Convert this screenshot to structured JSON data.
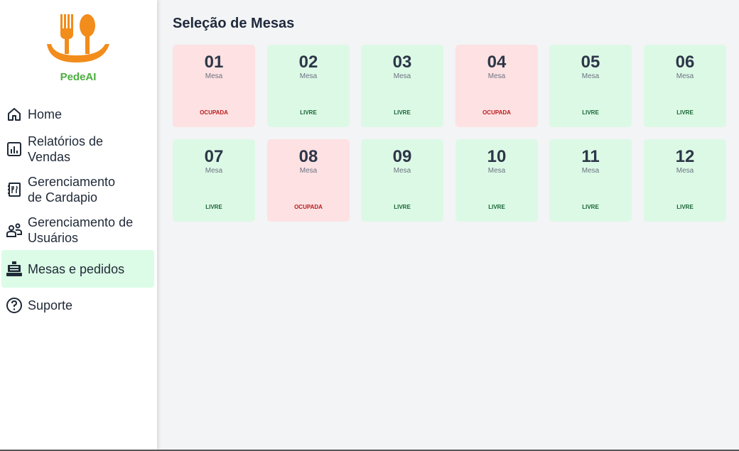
{
  "brand": {
    "name": "PedeAI",
    "primary": "#f28c1b",
    "green": "#4caf3f"
  },
  "nav": [
    {
      "label": "Home",
      "icon": "home-icon"
    },
    {
      "label": "Relatórios de Vendas",
      "icon": "chart-report-icon"
    },
    {
      "label": "Gerenciamento de Cardapio",
      "icon": "menu-book-icon"
    },
    {
      "label": "Gerenciamento de Usuários",
      "icon": "users-icon"
    },
    {
      "label": "Mesas e pedidos",
      "icon": "cash-register-icon",
      "active": true
    },
    {
      "label": "Suporte",
      "icon": "help-circle-icon"
    }
  ],
  "main": {
    "title": "Seleção de Mesas",
    "table_label": "Mesa",
    "tables": [
      {
        "number": "01",
        "status": "OCUPADA"
      },
      {
        "number": "02",
        "status": "LIVRE"
      },
      {
        "number": "03",
        "status": "LIVRE"
      },
      {
        "number": "04",
        "status": "OCUPADA"
      },
      {
        "number": "05",
        "status": "LIVRE"
      },
      {
        "number": "06",
        "status": "LIVRE"
      },
      {
        "number": "07",
        "status": "LIVRE"
      },
      {
        "number": "08",
        "status": "OCUPADA"
      },
      {
        "number": "09",
        "status": "LIVRE"
      },
      {
        "number": "10",
        "status": "LIVRE"
      },
      {
        "number": "11",
        "status": "LIVRE"
      },
      {
        "number": "12",
        "status": "LIVRE"
      }
    ]
  }
}
